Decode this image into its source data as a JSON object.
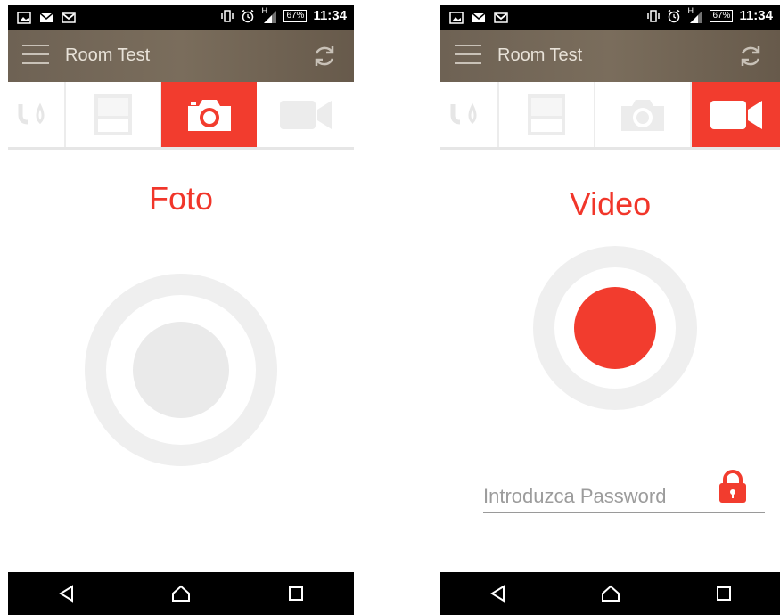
{
  "status_bar": {
    "battery": "67%",
    "time": "11:34",
    "signal_label": "H",
    "icons": [
      "image-icon",
      "mail-icon",
      "gmail-icon",
      "vibrate-icon",
      "alarm-icon",
      "signal-icon",
      "battery-icon"
    ]
  },
  "app_bar": {
    "title": "Room Test",
    "menu_icon": "hamburger-menu-icon",
    "refresh_icon": "refresh-icon"
  },
  "tabs": [
    {
      "icon": "sprinkler-icon"
    },
    {
      "icon": "blind-icon"
    },
    {
      "icon": "camera-icon"
    },
    {
      "icon": "video-camera-icon"
    }
  ],
  "screens": [
    {
      "active_tab": "camera",
      "title": "Foto",
      "capture_button": "photo-shutter-button"
    },
    {
      "active_tab": "video",
      "title": "Video",
      "capture_button": "record-button",
      "password": {
        "placeholder": "Introduzca Password",
        "value": ""
      }
    }
  ],
  "colors": {
    "accent": "#f23c2e",
    "record": "#f23c2e",
    "app_bar": "#73675a",
    "ring": "#efefef",
    "shutter": "#eaeaea"
  },
  "nav_bar": {
    "buttons": [
      "back-icon",
      "home-icon",
      "recents-icon"
    ]
  }
}
